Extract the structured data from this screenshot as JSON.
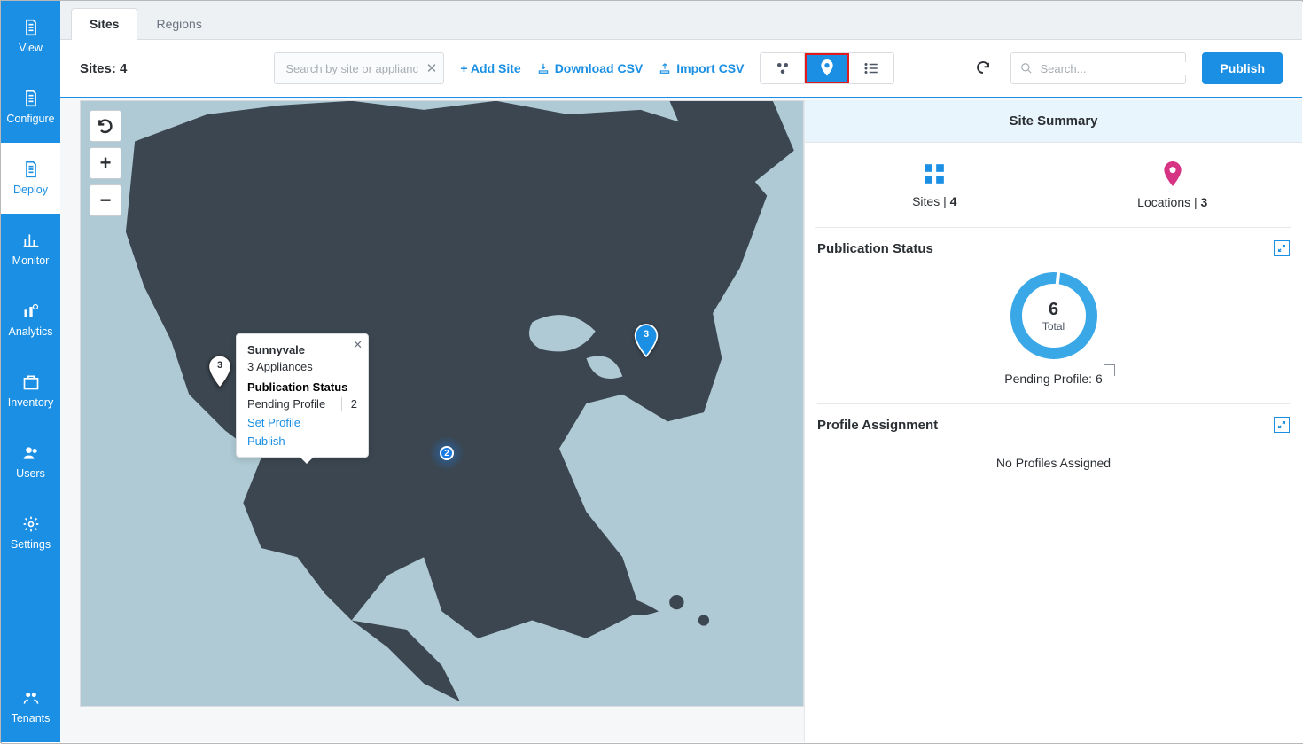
{
  "sidebar": {
    "items": [
      {
        "id": "view",
        "label": "View"
      },
      {
        "id": "configure",
        "label": "Configure"
      },
      {
        "id": "deploy",
        "label": "Deploy"
      },
      {
        "id": "monitor",
        "label": "Monitor"
      },
      {
        "id": "analytics",
        "label": "Analytics"
      },
      {
        "id": "inventory",
        "label": "Inventory"
      },
      {
        "id": "users",
        "label": "Users"
      },
      {
        "id": "settings",
        "label": "Settings"
      },
      {
        "id": "tenants",
        "label": "Tenants"
      }
    ],
    "active": "deploy"
  },
  "tabs": {
    "items": [
      {
        "id": "sites",
        "label": "Sites"
      },
      {
        "id": "regions",
        "label": "Regions"
      }
    ],
    "active": "sites"
  },
  "toolbar": {
    "sites_count_label": "Sites: 4",
    "search_placeholder": "Search by site or appliance",
    "add_site": "+ Add Site",
    "download_csv": "Download CSV",
    "import_csv": "Import CSV",
    "right_search_placeholder": "Search...",
    "publish": "Publish"
  },
  "map": {
    "popup": {
      "title": "Sunnyvale",
      "appliances": "3 Appliances",
      "section": "Publication Status",
      "pending_label": "Pending Profile",
      "pending_value": "2",
      "link_set_profile": "Set Profile",
      "link_publish": "Publish"
    },
    "pins": [
      {
        "id": "west",
        "count": "3",
        "style": "white"
      },
      {
        "id": "east",
        "count": "3",
        "style": "blue"
      }
    ],
    "pulse": {
      "count": "2"
    }
  },
  "summary": {
    "header": "Site Summary",
    "sites_label": "Sites | ",
    "sites_value": "4",
    "locations_label": "Locations | ",
    "locations_value": "3",
    "pub_status": {
      "title": "Publication Status",
      "total_n": "6",
      "total_t": "Total",
      "pending_label": "Pending Profile:  6"
    },
    "profile_assignment": {
      "title": "Profile Assignment",
      "message": "No Profiles Assigned"
    }
  },
  "chart_data": {
    "type": "pie",
    "title": "Publication Status",
    "total": 6,
    "slices": [
      {
        "name": "Pending Profile",
        "value": 6,
        "color": "#3aa7e6"
      }
    ]
  }
}
